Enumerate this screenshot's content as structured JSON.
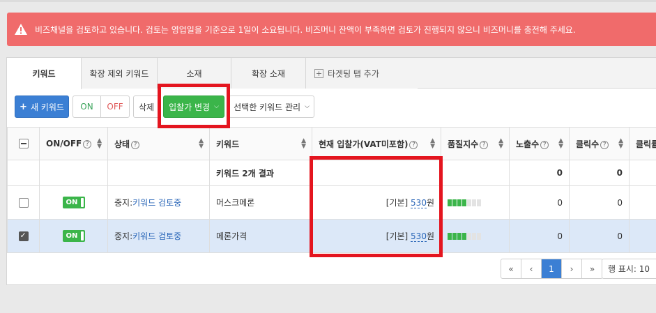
{
  "alert": {
    "message": "비즈채널을 검토하고 있습니다. 검토는 영업일을 기준으로 1일이 소요됩니다. 비즈머니 잔액이 부족하면 검토가 진행되지 않으니 비즈머니를 충전해 주세요."
  },
  "tabs": [
    {
      "label": "키워드"
    },
    {
      "label": "확장 제외 키워드"
    },
    {
      "label": "소재"
    },
    {
      "label": "확장 소재"
    },
    {
      "label": "타겟팅 탭 추가"
    }
  ],
  "toolbar": {
    "new_keyword": "새 키워드",
    "on": "ON",
    "off": "OFF",
    "delete": "삭제",
    "bid_change": "입찰가 변경",
    "manage_selected": "선택한 키워드 관리"
  },
  "table": {
    "columns": [
      "ON/OFF",
      "상태",
      "키워드",
      "현재 입찰가(VAT미포함)",
      "품질지수",
      "노출수",
      "클릭수",
      "클릭률"
    ],
    "summary": {
      "label": "키워드 2개 결과",
      "impressions": "0",
      "clicks": "0"
    },
    "rows": [
      {
        "toggle": "ON",
        "status_prefix": "중지:",
        "status_link": "키워드 검토중",
        "keyword": "머스크메론",
        "bid_prefix": "[기본]",
        "bid_value": "530",
        "bid_unit": "원",
        "quality": 4,
        "impressions": "0",
        "clicks": "0",
        "checked": false
      },
      {
        "toggle": "ON",
        "status_prefix": "중지:",
        "status_link": "키워드 검토중",
        "keyword": "메론가격",
        "bid_prefix": "[기본]",
        "bid_value": "530",
        "bid_unit": "원",
        "quality": 4,
        "impressions": "0",
        "clicks": "0",
        "checked": true
      }
    ]
  },
  "pagination": {
    "first": "«",
    "prev": "‹",
    "current": "1",
    "next": "›",
    "last": "»",
    "rows_per_page": "행 표시: 10"
  },
  "colors": {
    "alert": "#f06b6b",
    "primary": "#3b7fd4",
    "green": "#3bb54a",
    "highlight": "#e4151f",
    "selected_row": "#dce8f8"
  }
}
